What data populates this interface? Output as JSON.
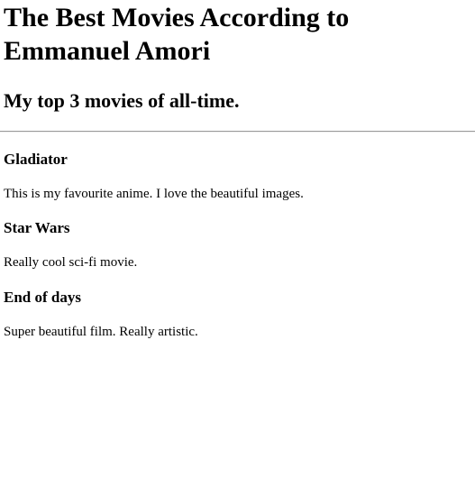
{
  "page": {
    "title": "The Best Movies According to Emmanuel Amori",
    "subtitle": "My top 3 movies of all-time."
  },
  "movies": [
    {
      "title": "Gladiator",
      "description": "This is my favourite anime. I love the beautiful images."
    },
    {
      "title": "Star Wars",
      "description": "Really cool sci-fi movie."
    },
    {
      "title": "End of days",
      "description": "Super beautiful film. Really artistic."
    }
  ]
}
